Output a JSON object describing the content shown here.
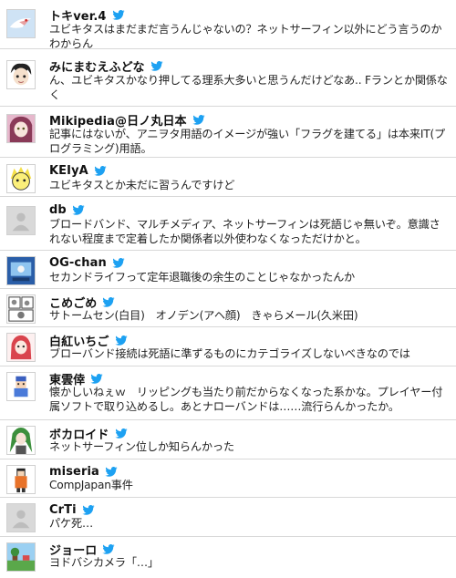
{
  "tweets": [
    {
      "name": "トキver.4",
      "avatar": "toki-bird-avatar",
      "text": "ユビキタスはまだまだ言うんじゃないの？ネットサーフィン以外にどう言うのかわからん"
    },
    {
      "name": "みにまむえふどな",
      "avatar": "anime-boy-avatar",
      "text": "ん、ユビキタスかなり押してる理系大多いと思うんだけどなあ.. Fランとか関係なく"
    },
    {
      "name": "Mikipedia@日ノ丸日本",
      "avatar": "anime-girl-avatar",
      "text": "記事にはないが、アニヲタ用語のイメージが強い「フラグを建てる」は本来IT(プログラミング)用語。"
    },
    {
      "name": "KEIyA",
      "avatar": "yellow-character-avatar",
      "text": "ユビキタスとか未だに習うんですけど"
    },
    {
      "name": "db",
      "avatar": "default-no-image-avatar",
      "text": "ブロードバンド、マルチメディア、ネットサーフィンは死語じゃ無いぞ。意識されない程度まで定着したか関係者以外使わなくなっただけかと。"
    },
    {
      "name": "OG-chan",
      "avatar": "blue-screen-avatar",
      "text": "セカンドライフって定年退職後の余生のことじゃなかったんか"
    },
    {
      "name": "こめごめ",
      "avatar": "manga-panel-avatar",
      "text": "サトームセン(白目)　オノデン(アヘ顔)　きゃらメール(久米田)"
    },
    {
      "name": "白紅いちご",
      "avatar": "red-hair-girl-avatar",
      "text": "ブローバンド接続は死語に準ずるものにカテゴライズしないべきなのでは"
    },
    {
      "name": "東雲倖",
      "avatar": "pixel-character-avatar",
      "text": "懐かしいねぇｗ　リッピングも当たり前だからなくなった系かな。プレイヤー付属ソフトで取り込めるし。あとナローバンドは……流行らんかったか。"
    },
    {
      "name": "ボカロイド",
      "avatar": "green-hair-avatar",
      "text": "ネットサーフィン位しか知らんかった"
    },
    {
      "name": "miseria",
      "avatar": "orange-figure-avatar",
      "text": "CompJapan事件"
    },
    {
      "name": "CrTi",
      "avatar": "default-no-image-avatar",
      "text": "パケ死…"
    },
    {
      "name": "ジョーロ",
      "avatar": "pixel-landscape-avatar",
      "text": "ヨドバシカメラ「…」"
    }
  ],
  "colors": {
    "twitter_blue": "#1da1f2",
    "divider": "#d8d8d8"
  }
}
